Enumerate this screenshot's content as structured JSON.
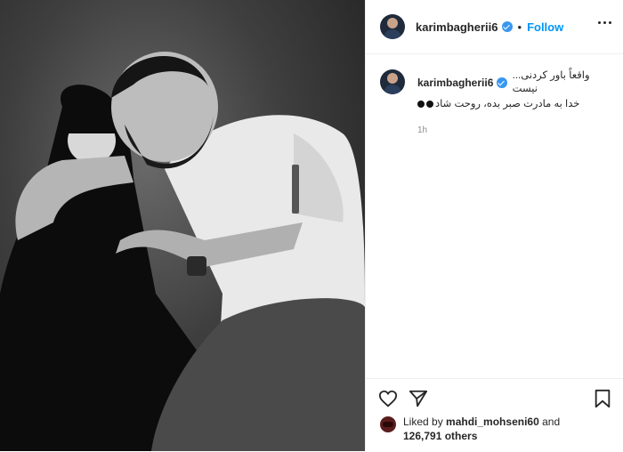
{
  "post": {
    "username": "karimbagherii6",
    "follow_label": "Follow",
    "dot": "•",
    "caption_line1": "...واقعاً باور کردنی نیست",
    "caption_line2": "خدا به مادرت صبر بده، روحت شاد",
    "time": "1h"
  },
  "likes": {
    "prefix": "Liked by",
    "user": "mahdi_mohseni60",
    "and": "and",
    "count": "126,791 others"
  },
  "icons": {
    "like": "heart-icon",
    "share": "paper-plane-icon",
    "save": "bookmark-icon",
    "more": "more-dots-icon",
    "verified": "verified-badge-icon"
  },
  "colors": {
    "accent": "#0095f6",
    "verified": "#3897f0",
    "text": "#262626",
    "muted": "#8e8e8e"
  }
}
